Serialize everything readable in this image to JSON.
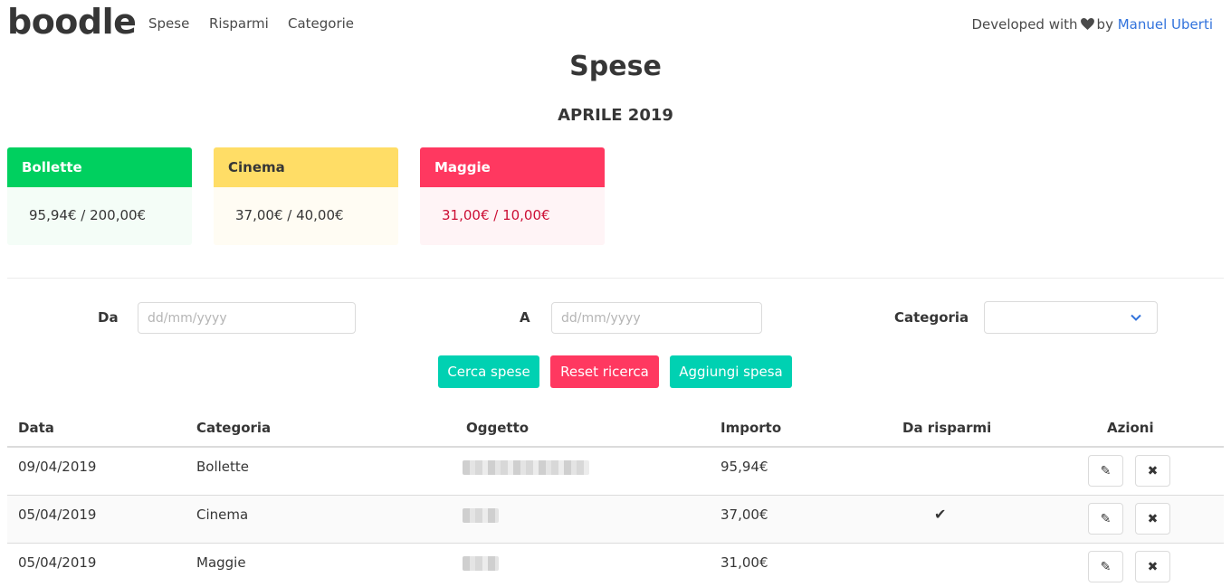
{
  "navbar": {
    "brand": "boodle",
    "items": [
      {
        "label": "Spese"
      },
      {
        "label": "Risparmi"
      },
      {
        "label": "Categorie"
      }
    ],
    "developed_with": "Developed with",
    "heart_icon": "heart-icon",
    "by": "by",
    "author": "Manuel Uberti"
  },
  "page": {
    "title": "Spese",
    "month": "APRILE 2019"
  },
  "budgets": [
    {
      "category": "Bollette",
      "amount": "95,94€ / 200,00€",
      "color": "#00d05f"
    },
    {
      "category": "Cinema",
      "amount": "37,00€ / 40,00€",
      "color": "#ffdd66"
    },
    {
      "category": "Maggie",
      "amount": "31,00€ / 10,00€",
      "color": "#ff3860"
    }
  ],
  "filters": {
    "from_label": "Da",
    "from_placeholder": "dd/mm/yyyy",
    "to_label": "A",
    "to_placeholder": "dd/mm/yyyy",
    "category_label": "Categoria",
    "category_value": ""
  },
  "actions": {
    "search": "Cerca spese",
    "reset": "Reset ricerca",
    "add": "Aggiungi spesa"
  },
  "table": {
    "headers": [
      "Data",
      "Categoria",
      "Oggetto",
      "Importo",
      "Da risparmi",
      "Azioni"
    ],
    "rows": [
      {
        "date": "09/04/2019",
        "category": "Bollette",
        "amount": "95,94€",
        "from_savings": ""
      },
      {
        "date": "05/04/2019",
        "category": "Cinema",
        "amount": "37,00€",
        "from_savings": "✔"
      },
      {
        "date": "05/04/2019",
        "category": "Maggie",
        "amount": "31,00€",
        "from_savings": ""
      }
    ]
  },
  "colors": {
    "primary": "#00d1b2",
    "danger": "#ff3860",
    "link": "#3273dc"
  }
}
